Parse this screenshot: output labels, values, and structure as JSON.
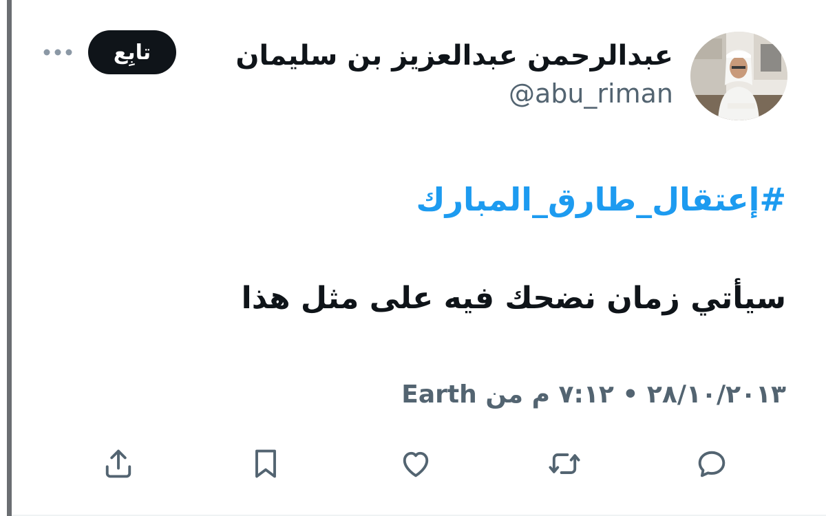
{
  "author": {
    "display_name": "عبدالرحمن عبدالعزيز بن سليمان",
    "handle": "@abu_riman"
  },
  "header": {
    "follow_label": "تابِع",
    "more_icon": "more-horizontal-icon"
  },
  "tweet": {
    "hashtag": "#إعتقال_طارق_المبارك",
    "text": "سيأتي زمان نضحك فيه على مثل هذا",
    "date": "٢٨/١٠/٢٠١٣",
    "separator": "•",
    "time": "٧:١٢ م",
    "source_prefix": "من",
    "source": "Earth"
  },
  "actions": {
    "icons": [
      "reply-icon",
      "retweet-icon",
      "like-icon",
      "bookmark-icon",
      "share-icon"
    ]
  },
  "colors": {
    "link": "#1d9bf0",
    "text": "#0f1419",
    "secondary": "#536471",
    "follow_bg": "#0f1419"
  }
}
